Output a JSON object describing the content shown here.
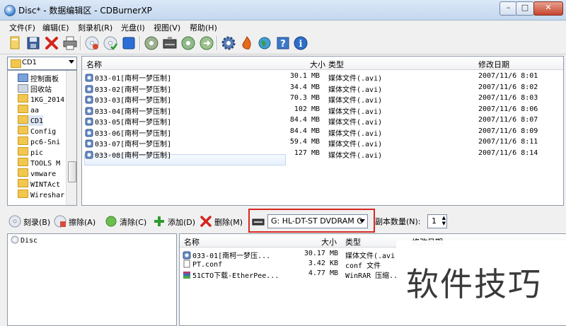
{
  "window": {
    "title": "Disc* - 数据编辑区 - CDBurnerXP"
  },
  "menu": [
    "文件(F)",
    "编辑(E)",
    "刻录机(R)",
    "光盘(I)",
    "视图(V)",
    "帮助(H)"
  ],
  "toolbar_icons": [
    "new-disc-icon",
    "save-icon",
    "delete-icon",
    "print-icon",
    "burn-disc-icon",
    "verify-disc-icon",
    "eject-blue-icon",
    "disc-info-icon",
    "drive-icon",
    "copy-disc-icon",
    "convert-disc-icon",
    "settings-gear-icon",
    "flame-icon",
    "globe-icon",
    "help-icon",
    "info-icon"
  ],
  "tree": {
    "selected_drive": "CD1",
    "items": [
      "控制面板",
      "回收站",
      "1KG_2014",
      "aa",
      "CD1",
      "Config",
      "pc6-Sni",
      "pic",
      "TOOLS M",
      "vmware",
      "WINTAct",
      "Wireshar"
    ]
  },
  "file_list": {
    "columns": [
      "名称",
      "大小",
      "类型",
      "修改日期"
    ],
    "rows": [
      {
        "name": "033-01[南柯一梦压制]",
        "size": "30.1 MB",
        "type": "媒体文件(.avi)",
        "date": "2007/11/6 8:01"
      },
      {
        "name": "033-02[南柯一梦压制]",
        "size": "34.4 MB",
        "type": "媒体文件(.avi)",
        "date": "2007/11/6 8:02"
      },
      {
        "name": "033-03[南柯一梦压制]",
        "size": "70.3 MB",
        "type": "媒体文件(.avi)",
        "date": "2007/11/6 8:03"
      },
      {
        "name": "033-04[南柯一梦压制]",
        "size": "102 MB",
        "type": "媒体文件(.avi)",
        "date": "2007/11/6 8:06"
      },
      {
        "name": "033-05[南柯一梦压制]",
        "size": "84.4 MB",
        "type": "媒体文件(.avi)",
        "date": "2007/11/6 8:07"
      },
      {
        "name": "033-06[南柯一梦压制]",
        "size": "84.4 MB",
        "type": "媒体文件(.avi)",
        "date": "2007/11/6 8:09"
      },
      {
        "name": "033-07[南柯一梦压制]",
        "size": "59.4 MB",
        "type": "媒体文件(.avi)",
        "date": "2007/11/6 8:11"
      },
      {
        "name": "033-08[南柯一梦压制]",
        "size": "127 MB",
        "type": "媒体文件(.avi)",
        "date": "2007/11/6 8:14"
      }
    ]
  },
  "action_bar": {
    "burn": "刻录(B)",
    "erase": "擦除(A)",
    "clear": "清除(C)",
    "add": "添加(D)",
    "remove": "删除(M)",
    "drive": "G: HL-DT-ST DVDRAM G",
    "copies_label": "副本数量(N):",
    "copies_value": "1"
  },
  "disc_tree": {
    "root": "Disc"
  },
  "disc_list": {
    "columns": [
      "名称",
      "大小",
      "类型",
      "修改日期"
    ],
    "rows": [
      {
        "name": "033-01[南柯一梦压...",
        "size": "30.17 MB",
        "type": "媒体文件(.avi"
      },
      {
        "name": "PT.conf",
        "size": "3.42 KB",
        "type": "conf 文件"
      },
      {
        "name": "51CTO下载-EtherPee...",
        "size": "4.77 MB",
        "type": "WinRAR 压缩..."
      }
    ]
  },
  "watermark": "软件技巧"
}
